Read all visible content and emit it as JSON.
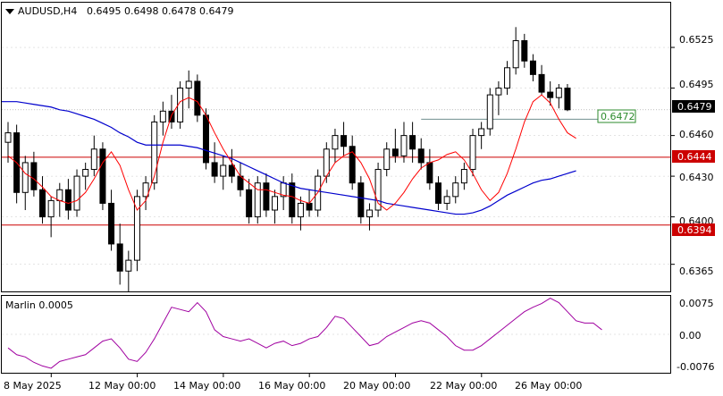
{
  "header": {
    "symbol_tf": "AUDUSD,H4",
    "ohlc": "0.6495 0.6498 0.6478 0.6479"
  },
  "indicator": {
    "name": "Marlin 0.0005",
    "axis_labels": [
      "0.0075",
      "0.00",
      "-0.0076"
    ]
  },
  "price_axis": {
    "labels": [
      "0.6525",
      "0.6495",
      "0.6460",
      "0.6430",
      "0.6400",
      "0.6365"
    ]
  },
  "time_axis": {
    "labels": [
      "8 May 2025",
      "12 May 00:00",
      "14 May 00:00",
      "16 May 00:00",
      "20 May 00:00",
      "22 May 00:00",
      "26 May 00:00"
    ]
  },
  "badges": {
    "current_price": "0.6479",
    "level_high": "0.6444",
    "level_low": "0.6394",
    "target": "0.6472"
  },
  "colors": {
    "background": "#ffffff",
    "candle": "#000000",
    "ma_fast": "#ff0000",
    "ma_slow": "#0000cd",
    "level_line": "#cc0000",
    "target_line": "#6f8f8f",
    "target_badge": "#2e8b2e",
    "oscillator": "#a000a0",
    "grid": "#c8c8c8"
  },
  "chart_data": {
    "type": "candlestick",
    "symbol": "AUDUSD",
    "timeframe": "H4",
    "ylim": [
      0.6345,
      0.6558
    ],
    "horizontal_levels": [
      0.6444,
      0.6394
    ],
    "target_level": 0.6472,
    "candles": [
      [
        0.6455,
        0.647,
        0.644,
        0.6462
      ],
      [
        0.6462,
        0.6468,
        0.641,
        0.6418
      ],
      [
        0.6418,
        0.6445,
        0.6405,
        0.644
      ],
      [
        0.644,
        0.6448,
        0.6415,
        0.642
      ],
      [
        0.642,
        0.643,
        0.6395,
        0.64
      ],
      [
        0.64,
        0.6415,
        0.6385,
        0.6412
      ],
      [
        0.6412,
        0.6425,
        0.64,
        0.642
      ],
      [
        0.642,
        0.6428,
        0.6398,
        0.6405
      ],
      [
        0.6405,
        0.6435,
        0.64,
        0.643
      ],
      [
        0.643,
        0.644,
        0.642,
        0.6435
      ],
      [
        0.6435,
        0.646,
        0.643,
        0.645
      ],
      [
        0.645,
        0.6455,
        0.6405,
        0.641
      ],
      [
        0.641,
        0.642,
        0.6375,
        0.638
      ],
      [
        0.638,
        0.6395,
        0.635,
        0.636
      ],
      [
        0.636,
        0.6375,
        0.6345,
        0.6368
      ],
      [
        0.6368,
        0.642,
        0.636,
        0.6415
      ],
      [
        0.6415,
        0.643,
        0.6405,
        0.6425
      ],
      [
        0.6425,
        0.6475,
        0.642,
        0.647
      ],
      [
        0.647,
        0.6485,
        0.646,
        0.6478
      ],
      [
        0.6478,
        0.649,
        0.6465,
        0.647
      ],
      [
        0.647,
        0.65,
        0.6465,
        0.6495
      ],
      [
        0.6495,
        0.6508,
        0.648,
        0.65
      ],
      [
        0.65,
        0.6505,
        0.647,
        0.6475
      ],
      [
        0.6475,
        0.648,
        0.6435,
        0.644
      ],
      [
        0.644,
        0.6455,
        0.6425,
        0.643
      ],
      [
        0.643,
        0.6445,
        0.642,
        0.6438
      ],
      [
        0.6438,
        0.645,
        0.6425,
        0.643
      ],
      [
        0.643,
        0.644,
        0.6415,
        0.642
      ],
      [
        0.642,
        0.6428,
        0.6395,
        0.64
      ],
      [
        0.64,
        0.643,
        0.6395,
        0.6425
      ],
      [
        0.6425,
        0.6432,
        0.64,
        0.6405
      ],
      [
        0.6405,
        0.642,
        0.6395,
        0.6415
      ],
      [
        0.6415,
        0.643,
        0.6405,
        0.6425
      ],
      [
        0.6425,
        0.6432,
        0.6395,
        0.64
      ],
      [
        0.64,
        0.6415,
        0.639,
        0.641
      ],
      [
        0.641,
        0.642,
        0.64,
        0.6405
      ],
      [
        0.6405,
        0.6435,
        0.64,
        0.643
      ],
      [
        0.643,
        0.6455,
        0.6425,
        0.645
      ],
      [
        0.645,
        0.6465,
        0.644,
        0.646
      ],
      [
        0.646,
        0.647,
        0.6445,
        0.6452
      ],
      [
        0.6452,
        0.646,
        0.642,
        0.6425
      ],
      [
        0.6425,
        0.643,
        0.6395,
        0.64
      ],
      [
        0.64,
        0.641,
        0.639,
        0.6405
      ],
      [
        0.6405,
        0.644,
        0.64,
        0.6435
      ],
      [
        0.6435,
        0.6455,
        0.643,
        0.645
      ],
      [
        0.645,
        0.6465,
        0.644,
        0.6445
      ],
      [
        0.6445,
        0.647,
        0.644,
        0.646
      ],
      [
        0.646,
        0.647,
        0.644,
        0.645
      ],
      [
        0.645,
        0.6458,
        0.6435,
        0.644
      ],
      [
        0.644,
        0.645,
        0.642,
        0.6425
      ],
      [
        0.6425,
        0.643,
        0.6405,
        0.641
      ],
      [
        0.641,
        0.642,
        0.6405,
        0.6415
      ],
      [
        0.6415,
        0.643,
        0.641,
        0.6425
      ],
      [
        0.6425,
        0.644,
        0.642,
        0.6435
      ],
      [
        0.6435,
        0.6465,
        0.643,
        0.646
      ],
      [
        0.646,
        0.647,
        0.645,
        0.6465
      ],
      [
        0.6465,
        0.6495,
        0.646,
        0.649
      ],
      [
        0.649,
        0.65,
        0.6475,
        0.6495
      ],
      [
        0.6495,
        0.6515,
        0.649,
        0.651
      ],
      [
        0.651,
        0.654,
        0.6505,
        0.653
      ],
      [
        0.653,
        0.6535,
        0.651,
        0.6515
      ],
      [
        0.6515,
        0.652,
        0.65,
        0.6505
      ],
      [
        0.6505,
        0.6512,
        0.649,
        0.6492
      ],
      [
        0.6492,
        0.65,
        0.6482,
        0.6488
      ],
      [
        0.6488,
        0.6498,
        0.648,
        0.6495
      ],
      [
        0.6495,
        0.6498,
        0.6478,
        0.6479
      ]
    ],
    "ma_fast": [
      0.6445,
      0.644,
      0.6432,
      0.6428,
      0.6422,
      0.6415,
      0.6412,
      0.641,
      0.6412,
      0.6418,
      0.6428,
      0.644,
      0.6448,
      0.6438,
      0.642,
      0.6405,
      0.6412,
      0.643,
      0.6455,
      0.6475,
      0.6485,
      0.6488,
      0.6485,
      0.6475,
      0.6462,
      0.645,
      0.644,
      0.643,
      0.6425,
      0.642,
      0.642,
      0.6418,
      0.6416,
      0.6415,
      0.6412,
      0.641,
      0.6418,
      0.643,
      0.644,
      0.6445,
      0.6448,
      0.644,
      0.6428,
      0.641,
      0.6405,
      0.641,
      0.6418,
      0.6428,
      0.6436,
      0.644,
      0.6442,
      0.6446,
      0.6448,
      0.6442,
      0.6432,
      0.642,
      0.6412,
      0.6418,
      0.6432,
      0.645,
      0.647,
      0.6485,
      0.649,
      0.6484,
      0.6472,
      0.6462,
      0.6458
    ],
    "ma_slow": [
      0.6485,
      0.6485,
      0.6484,
      0.6483,
      0.6482,
      0.6481,
      0.6479,
      0.6478,
      0.6476,
      0.6474,
      0.6472,
      0.6469,
      0.6466,
      0.6462,
      0.6459,
      0.6455,
      0.6453,
      0.6453,
      0.6453,
      0.6453,
      0.6453,
      0.6452,
      0.6451,
      0.6449,
      0.6447,
      0.6445,
      0.6443,
      0.644,
      0.6437,
      0.6434,
      0.6431,
      0.6428,
      0.6425,
      0.6423,
      0.6421,
      0.642,
      0.6419,
      0.6418,
      0.6417,
      0.6416,
      0.6415,
      0.6414,
      0.6413,
      0.6412,
      0.641,
      0.6409,
      0.6408,
      0.6407,
      0.6406,
      0.6405,
      0.6404,
      0.6403,
      0.6402,
      0.6402,
      0.6403,
      0.6405,
      0.6408,
      0.6412,
      0.6416,
      0.6419,
      0.6422,
      0.6425,
      0.6427,
      0.6428,
      0.643,
      0.6432,
      0.6434
    ],
    "oscillator": {
      "ylim": [
        -0.0085,
        0.0085
      ],
      "values": [
        -0.003,
        -0.0045,
        -0.005,
        -0.0062,
        -0.007,
        -0.0075,
        -0.006,
        -0.0055,
        -0.005,
        -0.0045,
        -0.003,
        -0.0015,
        -0.001,
        -0.003,
        -0.0055,
        -0.006,
        -0.004,
        -0.001,
        0.0025,
        0.006,
        0.0055,
        0.005,
        0.007,
        0.005,
        0.001,
        -0.0005,
        -0.001,
        -0.0015,
        -0.001,
        -0.002,
        -0.003,
        -0.002,
        -0.0015,
        -0.0025,
        -0.002,
        -0.001,
        -0.0005,
        0.0015,
        0.004,
        0.0035,
        0.0015,
        -0.0005,
        -0.0025,
        -0.002,
        -0.0005,
        0.0005,
        0.0015,
        0.0025,
        0.003,
        0.0025,
        0.001,
        -0.0005,
        -0.0025,
        -0.0035,
        -0.0035,
        -0.0025,
        -0.001,
        0.0005,
        0.002,
        0.0035,
        0.005,
        0.006,
        0.0068,
        0.008,
        0.007,
        0.005,
        0.003,
        0.0025,
        0.0025,
        0.001
      ]
    }
  }
}
